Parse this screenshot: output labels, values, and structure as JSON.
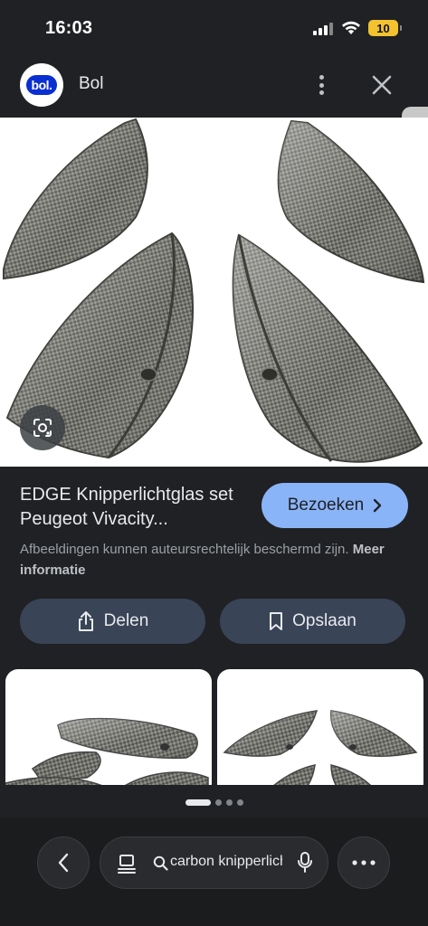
{
  "status_bar": {
    "time": "16:03",
    "battery": "10"
  },
  "header": {
    "site_name": "Bol",
    "logo_text": "bol."
  },
  "product": {
    "title": "EDGE Knipperlichtglas set Peugeot Vivacity...",
    "visit_label": "Bezoeken",
    "copyright_text": "Afbeeldingen kunnen auteursrechtelijk beschermd zijn.",
    "more_info_label": "Meer informatie",
    "share_label": "Delen",
    "save_label": "Opslaan"
  },
  "search": {
    "query": "carbon knipperlichtglas"
  },
  "pager": {
    "count": 4,
    "active_index": 0
  },
  "icons": {
    "more": "more-vert-icon",
    "close": "close-icon",
    "lens": "google-lens-icon",
    "share": "share-icon",
    "save": "bookmark-icon",
    "back": "chevron-left-icon",
    "tabs": "tabs-icon",
    "search": "search-icon",
    "mic": "mic-icon",
    "menu": "more-horiz-icon"
  },
  "colors": {
    "accent": "#8ab4f8",
    "background": "#202124",
    "button": "#394457",
    "brand": "#0a2fd1"
  }
}
